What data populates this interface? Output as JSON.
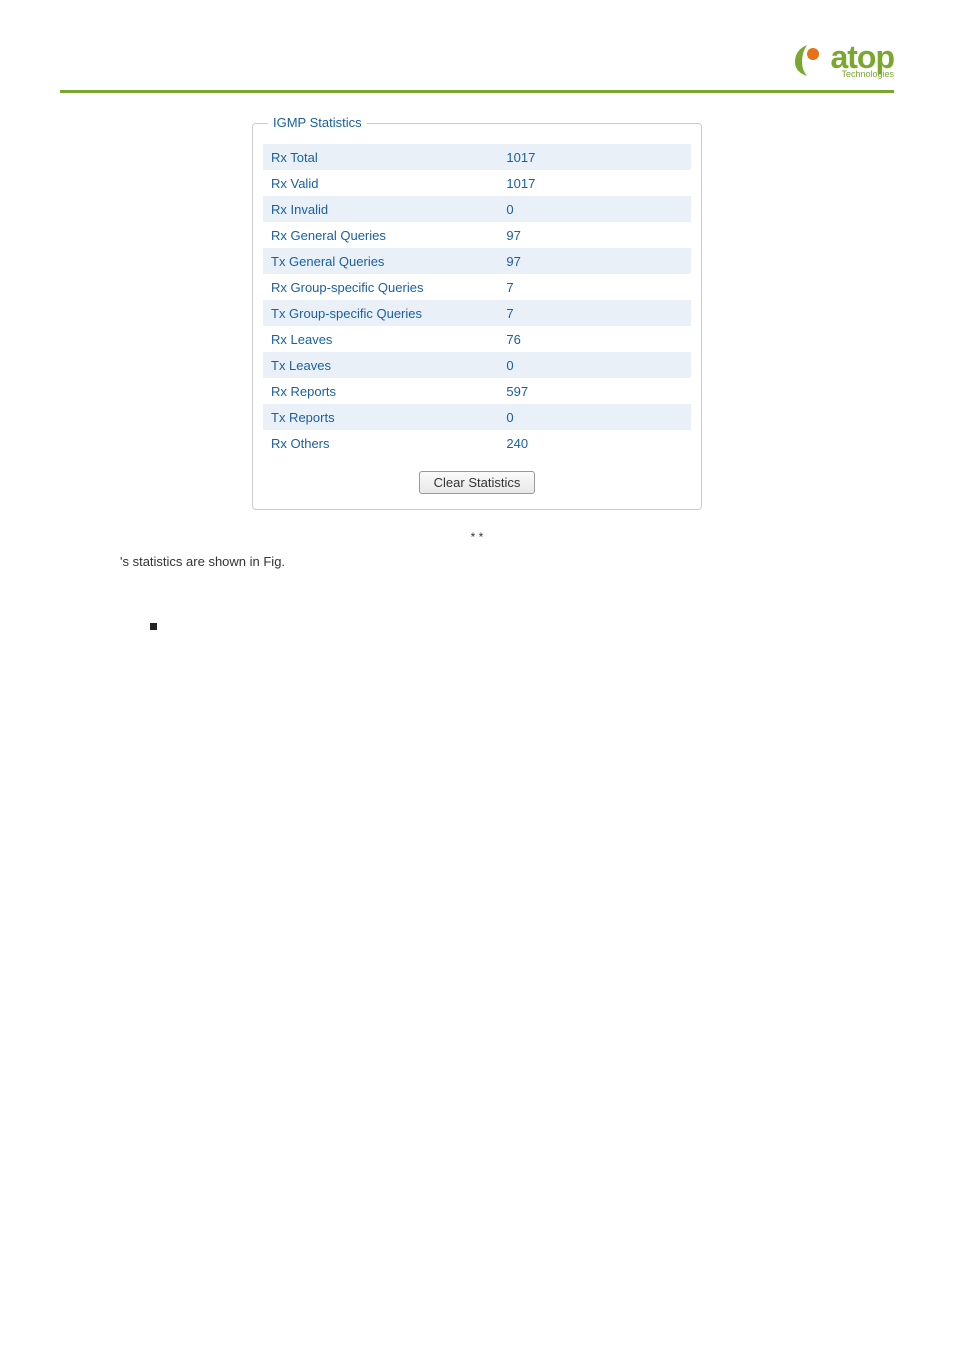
{
  "logo": {
    "main": "atop",
    "sub": "Technologies"
  },
  "panel": {
    "legend": "IGMP Statistics",
    "rows": [
      {
        "label": "Rx Total",
        "value": "1017"
      },
      {
        "label": "Rx Valid",
        "value": "1017"
      },
      {
        "label": "Rx Invalid",
        "value": "0"
      },
      {
        "label": "Rx General Queries",
        "value": "97"
      },
      {
        "label": "Tx General Queries",
        "value": "97"
      },
      {
        "label": "Rx Group-specific Queries",
        "value": "7"
      },
      {
        "label": "Tx Group-specific Queries",
        "value": "7"
      },
      {
        "label": "Rx Leaves",
        "value": "76"
      },
      {
        "label": "Tx Leaves",
        "value": "0"
      },
      {
        "label": "Rx Reports",
        "value": "597"
      },
      {
        "label": "Tx Reports",
        "value": "0"
      },
      {
        "label": "Rx Others",
        "value": "240"
      }
    ],
    "button": "Clear Statistics"
  },
  "caption_markers": "*        *",
  "body_text": "'s statistics are shown in Fig.",
  "bullets": [
    "",
    "",
    "",
    ""
  ]
}
